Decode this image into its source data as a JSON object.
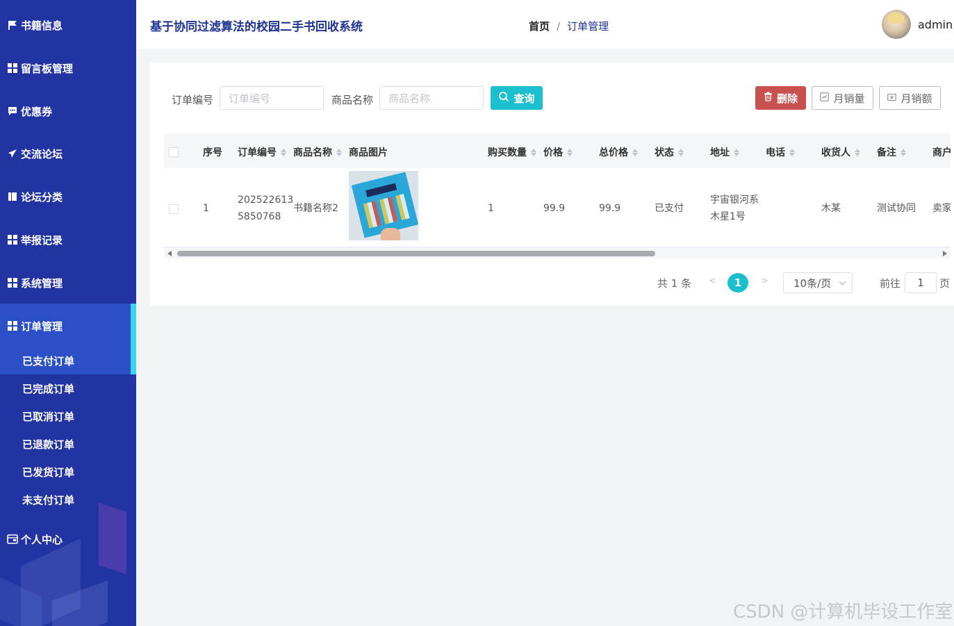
{
  "app": {
    "title": "基于协同过滤算法的校园二手书回收系统",
    "username": "admin"
  },
  "breadcrumb": {
    "home": "首页",
    "separator": "/",
    "current": "订单管理"
  },
  "sidebar": {
    "items": [
      {
        "label": "书籍信息",
        "icon": "flag-icon"
      },
      {
        "label": "留言板管理",
        "icon": "grid-icon"
      },
      {
        "label": "优惠券",
        "icon": "comment-icon"
      },
      {
        "label": "交流论坛",
        "icon": "send-icon"
      },
      {
        "label": "论坛分类",
        "icon": "book-icon"
      },
      {
        "label": "举报记录",
        "icon": "grid-icon"
      },
      {
        "label": "系统管理",
        "icon": "grid-icon"
      },
      {
        "label": "订单管理",
        "icon": "grid-icon"
      }
    ],
    "sub_items": [
      "已支付订单",
      "已完成订单",
      "已取消订单",
      "已退款订单",
      "已发货订单",
      "未支付订单"
    ],
    "personal": {
      "label": "个人中心",
      "icon": "wallet-icon"
    }
  },
  "search": {
    "order_no_label": "订单编号",
    "order_no_placeholder": "订单编号",
    "goods_name_label": "商品名称",
    "goods_name_placeholder": "商品名称",
    "query_label": "查询"
  },
  "actions": {
    "delete_label": "删除",
    "monthly_sales_label": "月销量",
    "monthly_revenue_label": "月销额"
  },
  "table": {
    "headers": {
      "index": "序号",
      "order_no": "订单编号",
      "goods_name": "商品名称",
      "goods_image": "商品图片",
      "quantity": "购买数量",
      "price": "价格",
      "total": "总价格",
      "status": "状态",
      "address": "地址",
      "phone": "电话",
      "receiver": "收货人",
      "remark": "备注",
      "merchant": "商户"
    },
    "rows": [
      {
        "index": "1",
        "order_no_line1": "202522613",
        "order_no_line2": "5850768",
        "goods_name": "书籍名称2",
        "quantity": "1",
        "price": "99.9",
        "total": "99.9",
        "status": "已支付",
        "address_line1": "宇宙银河系",
        "address_line2": "木星1号",
        "phone": "",
        "receiver": "木某",
        "remark": "测试协同",
        "merchant": "卖家"
      }
    ]
  },
  "pagination": {
    "total_text": "共 1 条",
    "prev": "<",
    "current_page": "1",
    "next": ">",
    "page_size": "10条/页",
    "goto_label": "前往",
    "goto_value": "1",
    "page_suffix": "页"
  },
  "watermark": "CSDN @计算机毕设工作室",
  "colors": {
    "sidebar": "#2233a2",
    "accent": "#1bbfd0",
    "danger": "#c8504f",
    "active_bar": "#38d4f0"
  }
}
